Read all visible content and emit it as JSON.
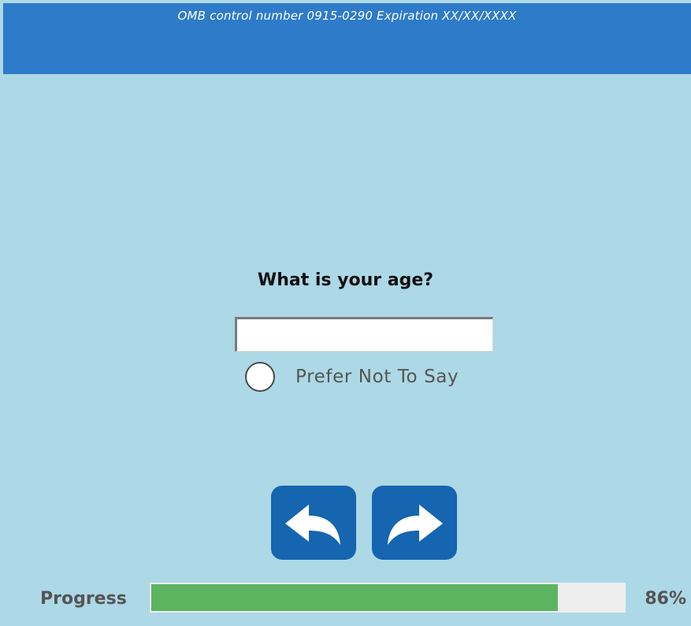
{
  "header": {
    "omb_text": "OMB control number 0915-0290 Expiration XX/XX/XXXX",
    "color": "#2e7bca"
  },
  "background_color": "#add8e6",
  "question": {
    "text": "What is your age?"
  },
  "age_input": {
    "value": "",
    "placeholder": ""
  },
  "prefer_not_option": {
    "label": "Prefer Not To Say",
    "checked": false
  },
  "nav": {
    "back_icon": "back-arrow-icon",
    "next_icon": "forward-arrow-icon",
    "button_color": "#1565b0"
  },
  "progress": {
    "label": "Progress",
    "percent_text": "86%",
    "fraction": 0.86,
    "fill_color": "#5cb461"
  }
}
